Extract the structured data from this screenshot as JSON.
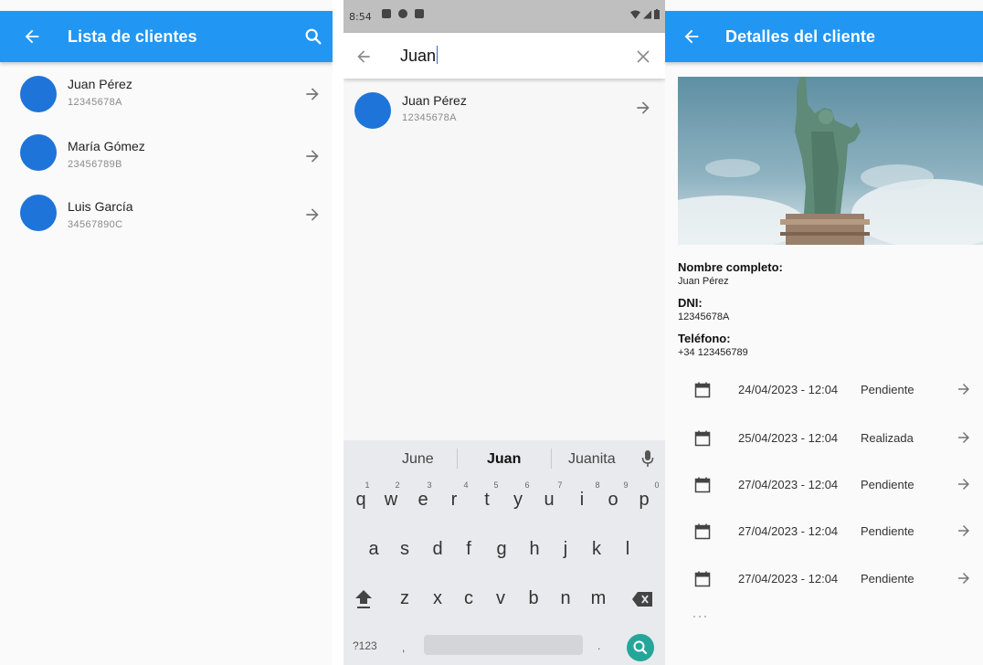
{
  "colors": {
    "primary": "#2196f3",
    "avatar": "#1e74d8",
    "fab": "#26a69a"
  },
  "list_screen": {
    "title": "Lista de clientes",
    "clients": [
      {
        "name": "Juan Pérez",
        "dni": "12345678A"
      },
      {
        "name": "María Gómez",
        "dni": "23456789B"
      },
      {
        "name": "Luis García",
        "dni": "34567890C"
      }
    ]
  },
  "search_screen": {
    "status_time": "8:54",
    "query": "Juan",
    "results": [
      {
        "name": "Juan Pérez",
        "dni": "12345678A"
      }
    ],
    "suggestions": [
      "June",
      "Juan",
      "Juanita"
    ],
    "keyboard": {
      "row1": [
        "q",
        "w",
        "e",
        "r",
        "t",
        "y",
        "u",
        "i",
        "o",
        "p"
      ],
      "row1_nums": [
        "1",
        "2",
        "3",
        "4",
        "5",
        "6",
        "7",
        "8",
        "9",
        "0"
      ],
      "row2": [
        "a",
        "s",
        "d",
        "f",
        "g",
        "h",
        "j",
        "k",
        "l"
      ],
      "row3": [
        "z",
        "x",
        "c",
        "v",
        "b",
        "n",
        "m"
      ],
      "symbols_key": "?123",
      "comma_key": ",",
      "period_key": "."
    }
  },
  "detail_screen": {
    "title": "Detalles del cliente",
    "name_label": "Nombre completo:",
    "name_value": "Juan Pérez",
    "dni_label": "DNI:",
    "dni_value": "12345678A",
    "phone_label": "Teléfono:",
    "phone_value": "+34 123456789",
    "appointments": [
      {
        "datetime": "24/04/2023 - 12:04",
        "status": "Pendiente"
      },
      {
        "datetime": "25/04/2023 - 12:04",
        "status": "Realizada"
      },
      {
        "datetime": "27/04/2023 - 12:04",
        "status": "Pendiente"
      },
      {
        "datetime": "27/04/2023 - 12:04",
        "status": "Pendiente"
      },
      {
        "datetime": "27/04/2023 - 12:04",
        "status": "Pendiente"
      }
    ]
  }
}
